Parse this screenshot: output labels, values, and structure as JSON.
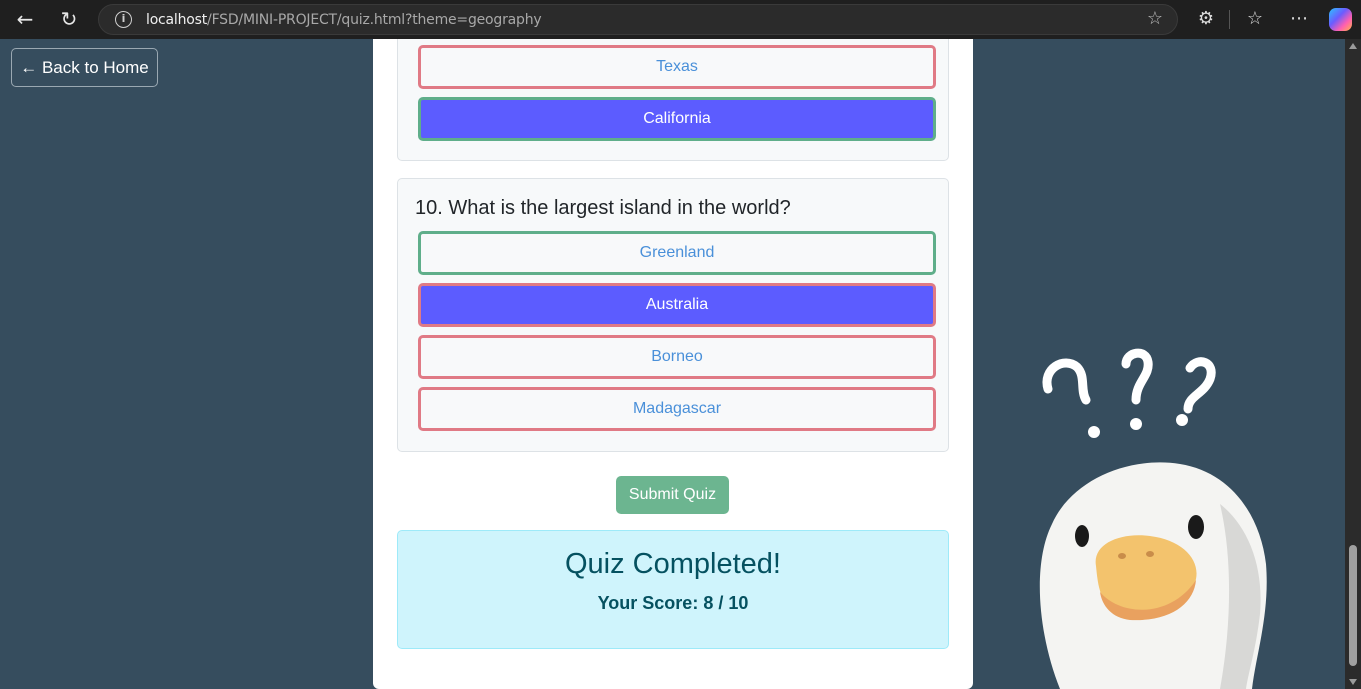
{
  "browser": {
    "url_host": "localhost",
    "url_path": "/FSD/MINI-PROJECT/quiz.html?theme=geography"
  },
  "page": {
    "back_label": "← Back to Home"
  },
  "quiz": {
    "previous_question": {
      "options": [
        {
          "label": "Texas",
          "state": "wrong"
        },
        {
          "label": "California",
          "state": "correct-selected"
        }
      ]
    },
    "question_10": {
      "text": "10. What is the largest island in the world?",
      "options": [
        {
          "label": "Greenland",
          "state": "correct"
        },
        {
          "label": "Australia",
          "state": "wrong-selected"
        },
        {
          "label": "Borneo",
          "state": "wrong"
        },
        {
          "label": "Madagascar",
          "state": "wrong"
        }
      ]
    },
    "submit_label": "Submit Quiz",
    "result": {
      "title": "Quiz Completed!",
      "score_text": "Your Score: 8 / 10"
    }
  },
  "colors": {
    "background": "#364d5e",
    "selected": "#5c5cff",
    "correct_border": "#5fae8a",
    "wrong_border": "#e07a85",
    "submit": "#6cb590",
    "result_bg": "#cff4fc"
  }
}
